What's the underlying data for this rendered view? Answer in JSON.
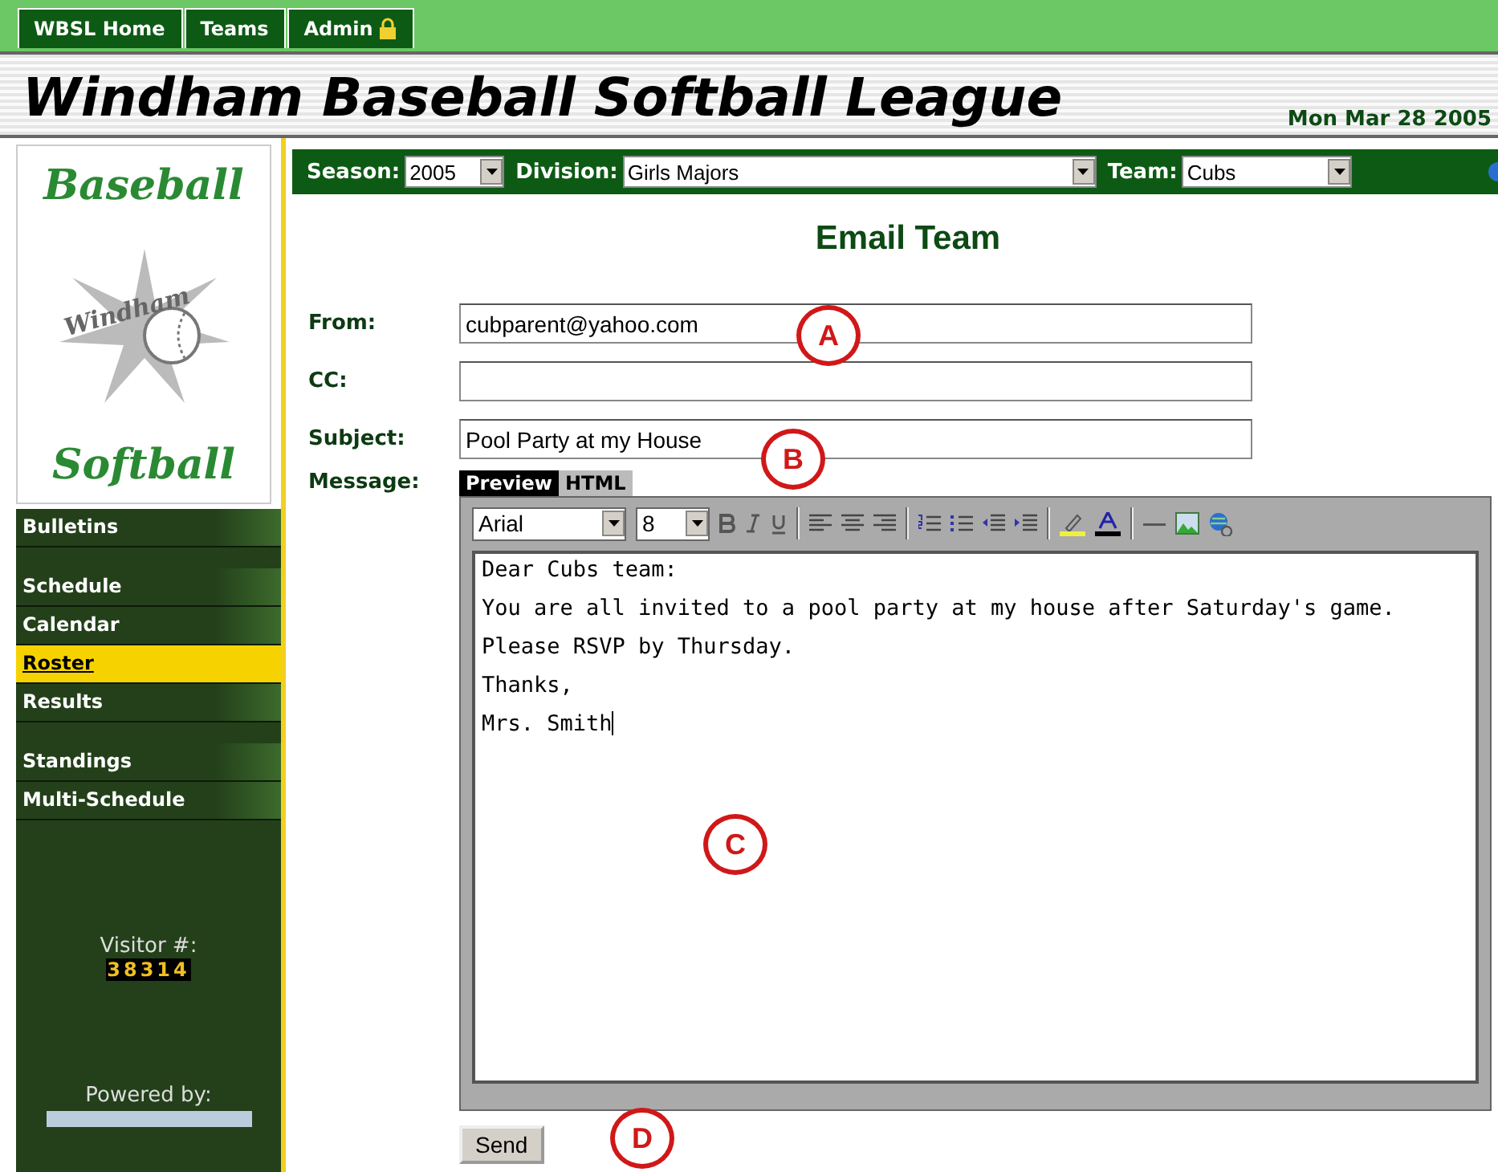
{
  "top_nav": [
    {
      "label": "WBSL Home",
      "locked": false
    },
    {
      "label": "Teams",
      "locked": false
    },
    {
      "label": "Admin",
      "locked": true
    }
  ],
  "header": {
    "title": "Windham Baseball Softball League",
    "date": "Mon Mar 28 2005"
  },
  "logo": {
    "top": "Baseball",
    "middle": "Windham",
    "bottom": "Softball"
  },
  "sidebar": {
    "groups": [
      [
        {
          "label": "Bulletins",
          "selected": false
        }
      ],
      [
        {
          "label": "Schedule",
          "selected": false
        },
        {
          "label": "Calendar",
          "selected": false
        },
        {
          "label": "Roster",
          "selected": true
        },
        {
          "label": "Results",
          "selected": false
        }
      ],
      [
        {
          "label": "Standings",
          "selected": false
        },
        {
          "label": "Multi-Schedule",
          "selected": false
        }
      ]
    ],
    "visitor_label": "Visitor #:",
    "visitor_count": "38314",
    "powered_by": "Powered by:"
  },
  "filters": [
    {
      "label": "Season:",
      "value": "2005"
    },
    {
      "label": "Division:",
      "value": "Girls Majors"
    },
    {
      "label": "Team:",
      "value": "Cubs"
    }
  ],
  "form": {
    "title": "Email Team",
    "fields": [
      {
        "label": "From:",
        "value": "cubparent@yahoo.com"
      },
      {
        "label": "CC:"
      },
      {
        "label": "Subject:",
        "value": "Pool Party at my House"
      }
    ],
    "message_label": "Message:",
    "editor_tabs": [
      {
        "label": "Preview",
        "selected": true
      },
      {
        "label": "HTML",
        "selected": false
      }
    ],
    "font": "Arial",
    "font_size": "8",
    "body": [
      "Dear Cubs team:",
      "You are all invited to a pool party at my house after Saturday's game.",
      "Please RSVP by Thursday.",
      "Thanks,",
      "Mrs. Smith"
    ],
    "send": "Send"
  },
  "annotations": [
    "A",
    "B",
    "C",
    "D"
  ]
}
